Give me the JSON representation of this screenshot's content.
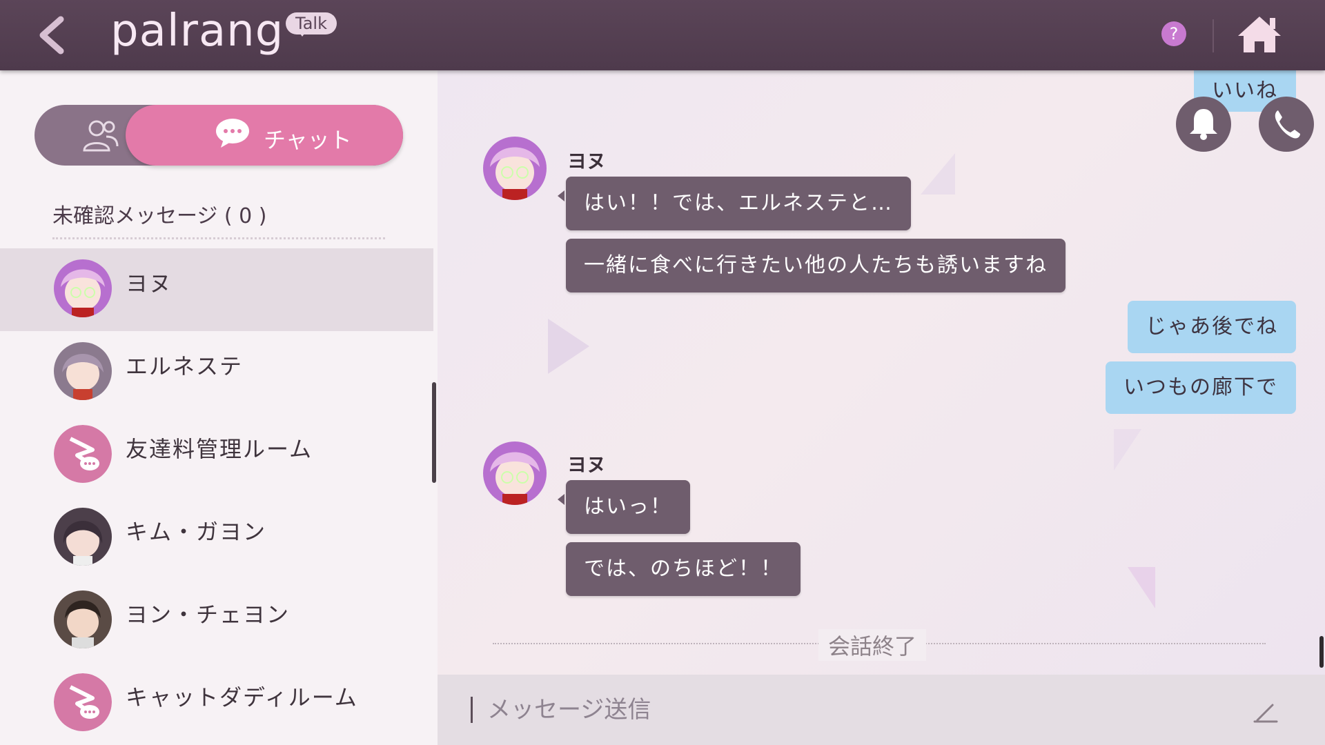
{
  "header": {
    "logo": "palrang",
    "badge": "Talk",
    "help": "?",
    "icons": {
      "back": "chevron-left-icon",
      "help": "question-icon",
      "home": "home-icon"
    }
  },
  "sidebar": {
    "toggle": {
      "chat_label": "チャット",
      "icons": {
        "friends": "friends-icon",
        "chat": "chat-bubble-icon"
      }
    },
    "unread_title": "未確認メッセージ ( 0 )",
    "items": [
      {
        "name": "ヨヌ",
        "active": true
      },
      {
        "name": "エルネステ",
        "active": false
      },
      {
        "name": "友達料管理ルーム",
        "active": false
      },
      {
        "name": "キム・ガヨン",
        "active": false
      },
      {
        "name": "ヨン・チェヨン",
        "active": false
      },
      {
        "name": "キャットダディルーム",
        "active": false
      }
    ]
  },
  "chat": {
    "top_partial_message": "いいね",
    "icons": {
      "bell": "bell-icon",
      "phone": "phone-icon"
    },
    "groups": [
      {
        "sender": "ヨヌ",
        "messages": [
          "はい！！では、エルネステと…",
          "一緒に食べに行きたい他の人たちも誘いますね"
        ]
      },
      {
        "sender": "ヨヌ",
        "messages": [
          "はいっ！",
          "では、のちほど！！"
        ]
      }
    ],
    "outgoing": [
      "じゃあ後でね",
      "いつもの廊下で"
    ],
    "end_label": "会話終了"
  },
  "input": {
    "placeholder": "メッセージ送信",
    "value": ""
  },
  "colors": {
    "topbar": "#4e3a4c",
    "accent_pink": "#e37aa9",
    "bubble_in": "#6f5d6d",
    "bubble_out": "#a9d6f2"
  }
}
